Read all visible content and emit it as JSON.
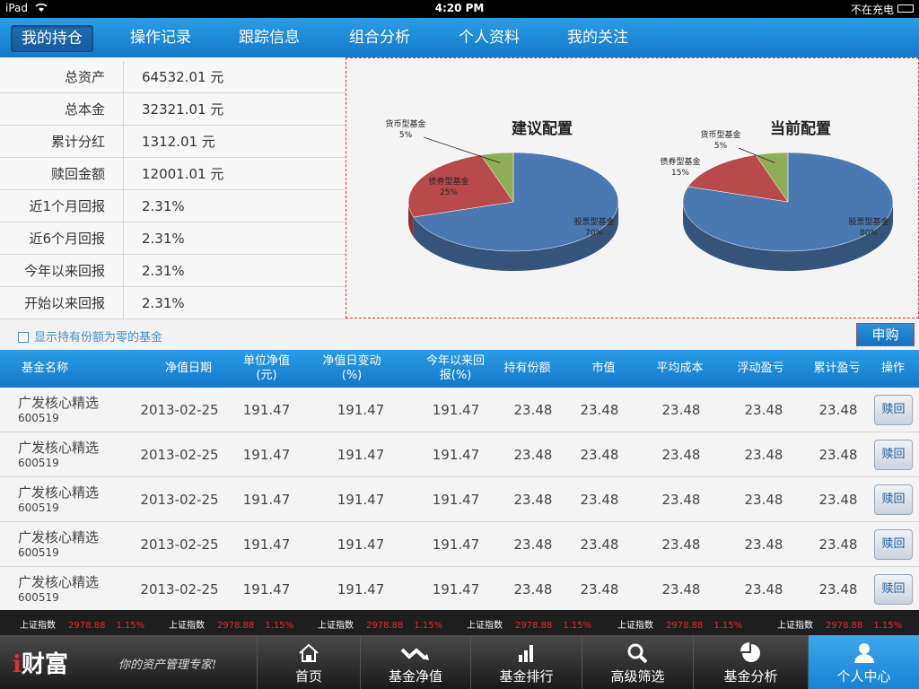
{
  "status": {
    "device": "iPad",
    "time": "4:20 PM",
    "charging": "不在充电"
  },
  "tabs": [
    "我的持仓",
    "操作记录",
    "跟踪信息",
    "组合分析",
    "个人资料",
    "我的关注"
  ],
  "summary": [
    {
      "label": "总资产",
      "value": "64532.01 元"
    },
    {
      "label": "总本金",
      "value": "32321.01 元"
    },
    {
      "label": "累计分红",
      "value": "1312.01 元"
    },
    {
      "label": "赎回金额",
      "value": "12001.01 元"
    },
    {
      "label": "近1个月回报",
      "value": "2.31%"
    },
    {
      "label": "近6个月回报",
      "value": "2.31%"
    },
    {
      "label": "今年以来回报",
      "value": "2.31%"
    },
    {
      "label": "开始以来回报",
      "value": "2.31%"
    }
  ],
  "chart_data": [
    {
      "type": "pie",
      "title": "建议配置",
      "slices": [
        {
          "name": "股票型基金",
          "value": 70,
          "label": "70%",
          "color": "#4a78b0"
        },
        {
          "name": "债券型基金",
          "value": 25,
          "label": "25%",
          "color": "#b94a4a"
        },
        {
          "name": "货币型基金",
          "value": 5,
          "label": "5%",
          "color": "#8fae5a"
        }
      ]
    },
    {
      "type": "pie",
      "title": "当前配置",
      "slices": [
        {
          "name": "股票型基金",
          "value": 80,
          "label": "80%",
          "color": "#4a78b0"
        },
        {
          "name": "债券型基金",
          "value": 15,
          "label": "15%",
          "color": "#b94a4a"
        },
        {
          "name": "货币型基金",
          "value": 5,
          "label": "5%",
          "color": "#8fae5a"
        }
      ]
    }
  ],
  "show_zero_label": "显示持有份额为零的基金",
  "buy_label": "申购",
  "table": {
    "headers": [
      "基金名称",
      "净值日期",
      "单位净值(元)",
      "净值日变动(%)",
      "今年以来回报(%)",
      "持有份额",
      "市值",
      "平均成本",
      "浮动盈亏",
      "累计盈亏",
      "操作"
    ],
    "rows": [
      {
        "name": "广发核心精选",
        "code": "600519",
        "date": "2013-02-25",
        "nav": "191.47",
        "change": "191.47",
        "ytd": "191.47",
        "shares": "23.48",
        "mv": "23.48",
        "cost": "23.48",
        "float": "23.48",
        "total": "23.48",
        "action": "赎回"
      },
      {
        "name": "广发核心精选",
        "code": "600519",
        "date": "2013-02-25",
        "nav": "191.47",
        "change": "191.47",
        "ytd": "191.47",
        "shares": "23.48",
        "mv": "23.48",
        "cost": "23.48",
        "float": "23.48",
        "total": "23.48",
        "action": "赎回"
      },
      {
        "name": "广发核心精选",
        "code": "600519",
        "date": "2013-02-25",
        "nav": "191.47",
        "change": "191.47",
        "ytd": "191.47",
        "shares": "23.48",
        "mv": "23.48",
        "cost": "23.48",
        "float": "23.48",
        "total": "23.48",
        "action": "赎回"
      },
      {
        "name": "广发核心精选",
        "code": "600519",
        "date": "2013-02-25",
        "nav": "191.47",
        "change": "191.47",
        "ytd": "191.47",
        "shares": "23.48",
        "mv": "23.48",
        "cost": "23.48",
        "float": "23.48",
        "total": "23.48",
        "action": "赎回"
      },
      {
        "name": "广发核心精选",
        "code": "600519",
        "date": "2013-02-25",
        "nav": "191.47",
        "change": "191.47",
        "ytd": "191.47",
        "shares": "23.48",
        "mv": "23.48",
        "cost": "23.48",
        "float": "23.48",
        "total": "23.48",
        "action": "赎回"
      }
    ]
  },
  "ticker": [
    {
      "name": "上证指数",
      "value": "2978.88",
      "pct": "1.15%"
    },
    {
      "name": "上证指数",
      "value": "2978.88",
      "pct": "1.15%"
    },
    {
      "name": "上证指数",
      "value": "2978.88",
      "pct": "1.15%"
    },
    {
      "name": "上证指数",
      "value": "2978.88",
      "pct": "1.15%"
    },
    {
      "name": "上证指数",
      "value": "2978.88",
      "pct": "1.15%"
    },
    {
      "name": "上证指数",
      "value": "2978.88",
      "pct": "1.15%"
    }
  ],
  "bottom": {
    "logo_i": "i",
    "logo_text": "财富",
    "slogan": "你的资产管理专家!",
    "nav": [
      {
        "label": "首页",
        "icon": "home-icon"
      },
      {
        "label": "基金净值",
        "icon": "trend-icon"
      },
      {
        "label": "基金排行",
        "icon": "bar-chart-icon"
      },
      {
        "label": "高级筛选",
        "icon": "search-icon"
      },
      {
        "label": "基金分析",
        "icon": "pie-icon"
      },
      {
        "label": "个人中心",
        "icon": "user-icon"
      }
    ]
  }
}
